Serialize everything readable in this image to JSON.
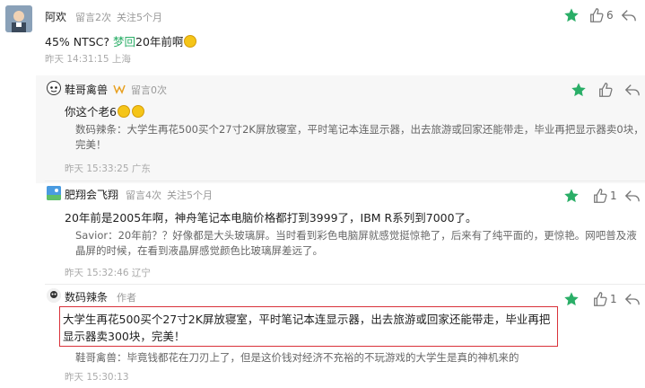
{
  "c1": {
    "user": "阿欢",
    "meta": [
      "留言2次",
      "关注5个月"
    ],
    "body_pre": "45% NTSC?  ",
    "body_mention": "梦回",
    "body_post": "20年前啊",
    "time": "昨天 14:31:15 上海",
    "likes": "6"
  },
  "r1": {
    "user": "鞋哥禽兽",
    "meta": [
      "留言0次"
    ],
    "body": "你这个老6",
    "quote": "数码辣条：大学生再花500买个27寸2K屏放寝室，平时笔记本连显示器，出去旅游或回家还能带走，毕业再把显示器卖0块，完美！",
    "time": "昨天 15:33:25 广东"
  },
  "r2": {
    "user": "肥翔会飞翔",
    "meta": [
      "留言4次",
      "关注5个月"
    ],
    "body": "20年前是2005年啊，神舟笔记本电脑价格都打到3999了，IBM R系列到7000了。",
    "quote": "Savior：20年前？？好像都是大头玻璃屏。当时看到彩色电脑屏就感觉挺惊艳了，后来有了纯平面的，更惊艳。网吧普及液晶屏的时候，在看到液晶屏感觉颜色比玻璃屏差远了。",
    "time": "昨天 15:32:46 辽宁",
    "likes": "1"
  },
  "r3": {
    "user": "数码辣条",
    "author_tag": "作者",
    "body": "大学生再花500买个27寸2K屏放寝室，平时笔记本连显示器，出去旅游或回家还能带走，毕业再把显示器卖300块，完美！",
    "quote": "鞋哥禽兽：毕竟钱都花在刀刃上了，但是这价钱对经济不充裕的不玩游戏的大学生是真的神机来的",
    "time": "昨天 15:30:13",
    "likes": "1"
  },
  "colors": {
    "accent": "#2aae67",
    "highlight": "#d9323a"
  }
}
